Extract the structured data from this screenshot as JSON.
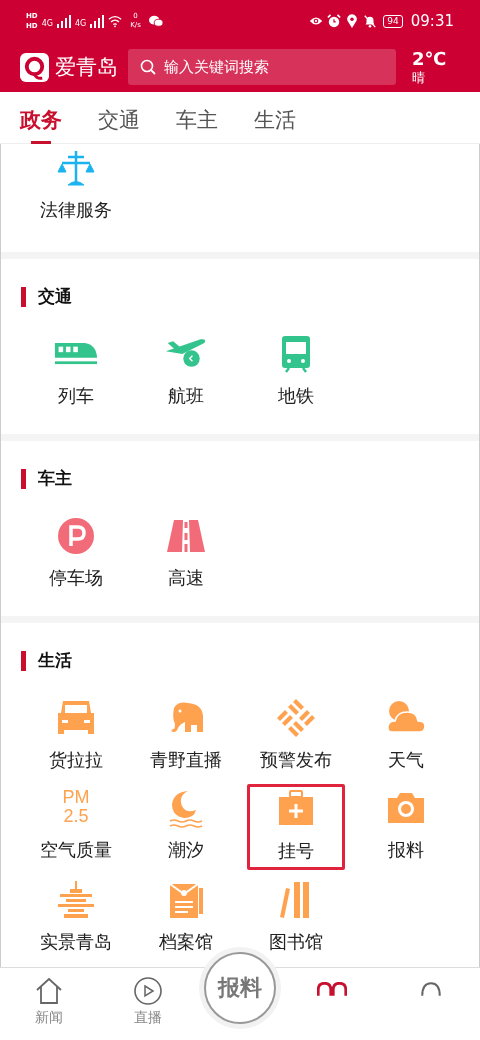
{
  "status_bar": {
    "sim_1": "HD",
    "sim_2": "HD",
    "net_1": "4G",
    "net_2": "4G",
    "speed_value": "0",
    "speed_unit": "K/s",
    "battery": "94",
    "time": "09:31"
  },
  "header": {
    "app_name": "爱青岛",
    "search": {
      "placeholder": "输入关键词搜索"
    },
    "temperature": "2℃",
    "weather": "晴"
  },
  "tabs": [
    {
      "label": "政务",
      "selected": true
    },
    {
      "label": "交通",
      "selected": false
    },
    {
      "label": "车主",
      "selected": false
    },
    {
      "label": "生活",
      "selected": false
    }
  ],
  "sections": [
    {
      "kind": "law",
      "items": [
        {
          "label": "法律服务",
          "highlighted": false
        }
      ]
    },
    {
      "kind": "traffic",
      "title": "交通",
      "items": [
        {
          "label": "列车",
          "highlighted": false
        },
        {
          "label": "航班",
          "highlighted": false
        },
        {
          "label": "地铁",
          "highlighted": false
        }
      ]
    },
    {
      "kind": "car",
      "title": "车主",
      "items": [
        {
          "label": "停车场",
          "highlighted": false
        },
        {
          "label": "高速",
          "highlighted": false
        }
      ]
    },
    {
      "kind": "life",
      "title": "生活",
      "items": [
        {
          "label": "货拉拉",
          "highlighted": false
        },
        {
          "label": "青野直播",
          "highlighted": false
        },
        {
          "label": "预警发布",
          "highlighted": false
        },
        {
          "label": "天气",
          "highlighted": false
        },
        {
          "label": "空气质量",
          "highlighted": false,
          "icon_text": "PM 2.5"
        },
        {
          "label": "潮汐",
          "highlighted": false
        },
        {
          "label": "挂号",
          "highlighted": true
        },
        {
          "label": "报料",
          "highlighted": false
        },
        {
          "label": "实景青岛",
          "highlighted": false
        },
        {
          "label": "档案馆",
          "highlighted": false
        },
        {
          "label": "图书馆",
          "highlighted": false
        }
      ]
    }
  ],
  "bottom_nav": [
    {
      "label": "新闻",
      "selected": false
    },
    {
      "label": "直播",
      "selected": false
    },
    {
      "kind": "report",
      "label": "报料",
      "selected": false
    },
    {
      "selected": true
    },
    {
      "selected": false
    }
  ]
}
